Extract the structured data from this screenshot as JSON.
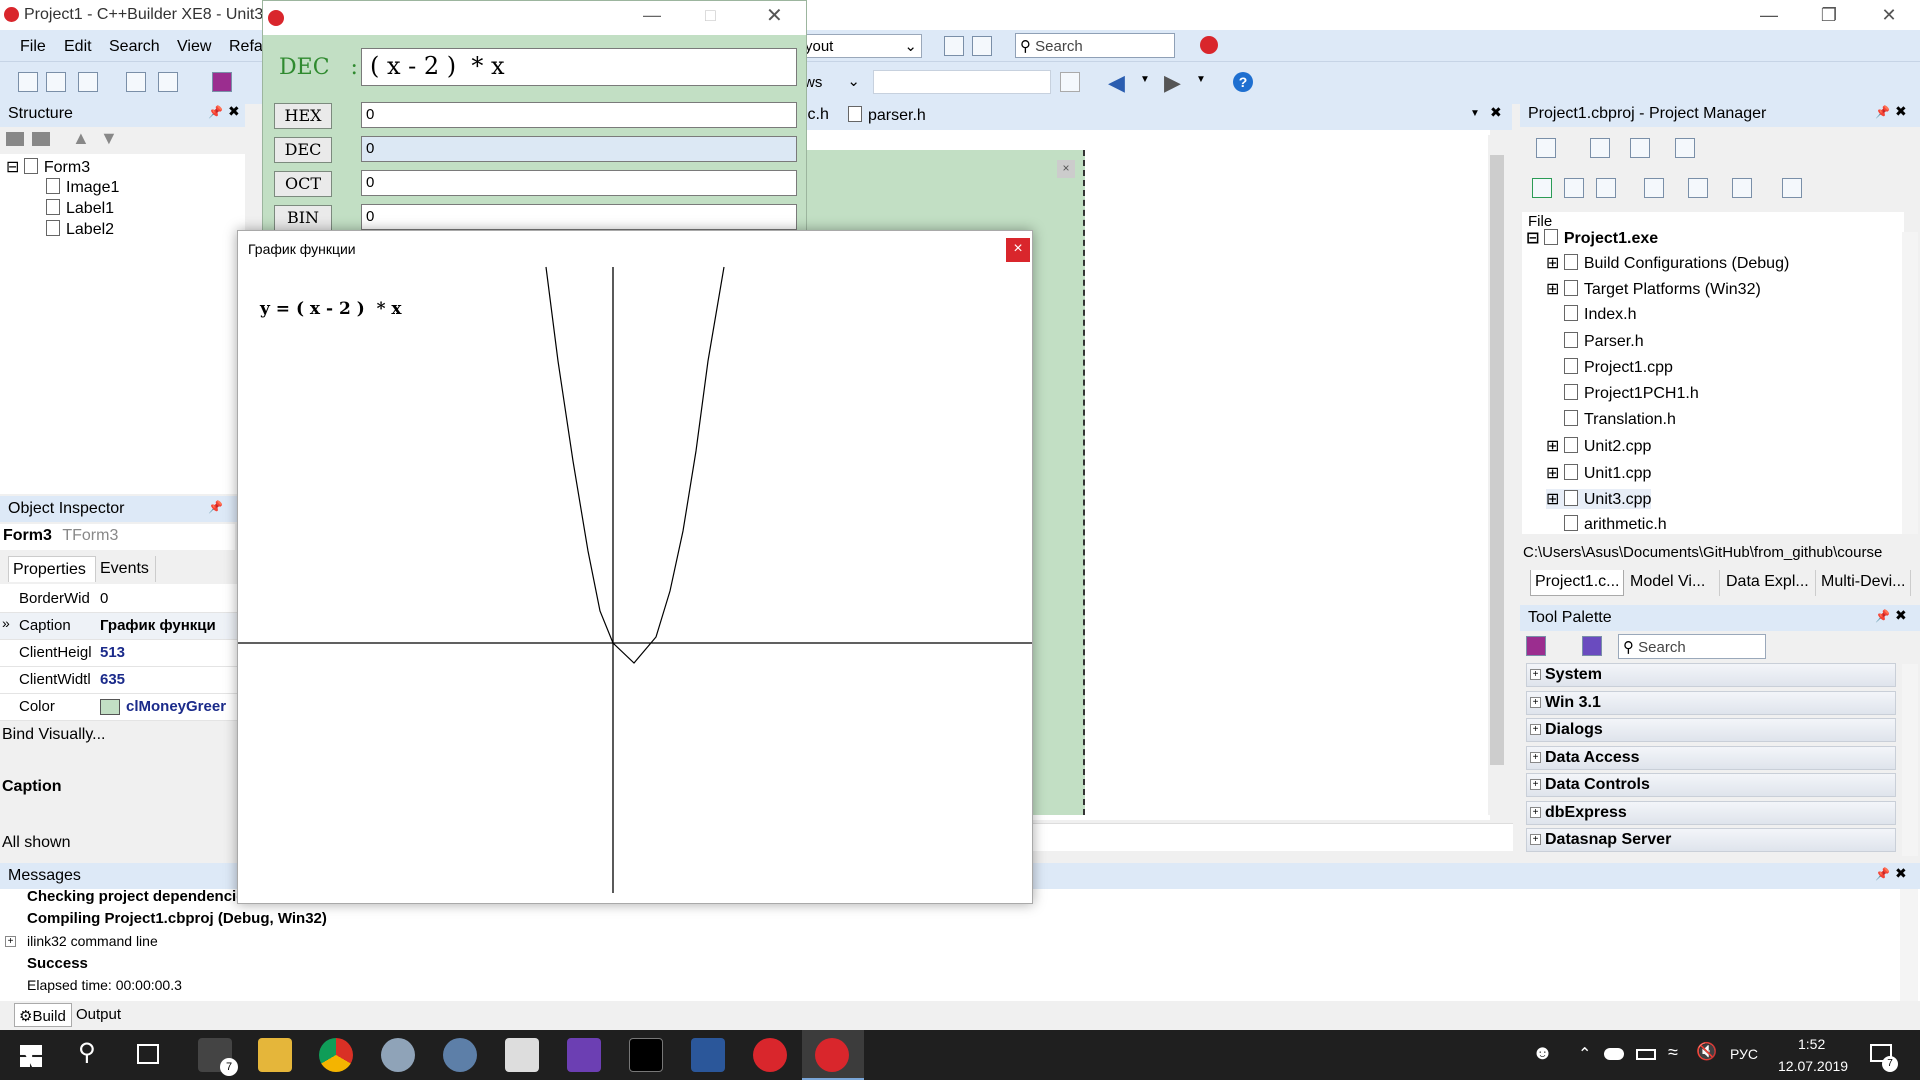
{
  "ide": {
    "title": "Project1 - C++Builder XE8 - Unit3.c",
    "menu": [
      "File",
      "Edit",
      "Search",
      "View",
      "Refa"
    ],
    "layout_combo": "yout",
    "layout_combo2": "ws",
    "search_placeholder": "Search",
    "editor_tabs": [
      "ic.h",
      "parser.h"
    ]
  },
  "calc": {
    "expression_label": "DEC   :",
    "expression": "( x - 2 )  * x",
    "rows": [
      {
        "label": "HEX",
        "value": "0"
      },
      {
        "label": "DEC",
        "value": "0"
      },
      {
        "label": "OCT",
        "value": "0"
      },
      {
        "label": "BIN",
        "value": "0"
      }
    ]
  },
  "graph": {
    "title": "График функции",
    "formula": "y = ( x - 2 )  * x",
    "close": "×"
  },
  "structure": {
    "title": "Structure",
    "items": [
      "Form3",
      "Image1",
      "Label1",
      "Label2"
    ]
  },
  "inspector": {
    "title": "Object Inspector",
    "object": "Form3",
    "object_type": "TForm3",
    "tabs": [
      "Properties",
      "Events"
    ],
    "props": [
      {
        "name": "BorderWid",
        "value": "0"
      },
      {
        "name": "Caption",
        "value": "График функци"
      },
      {
        "name": "ClientHeigl",
        "value": "513"
      },
      {
        "name": "ClientWidtl",
        "value": "635"
      },
      {
        "name": "Color",
        "value": "clMoneyGreer"
      }
    ],
    "bind_visually": "Bind Visually...",
    "selected_prop": "Caption",
    "all_shown": "All shown"
  },
  "messages": {
    "title": "Messages",
    "lines": [
      "Checking project dependencie",
      "Compiling Project1.cbproj (Debug, Win32)",
      "ilink32 command line",
      "Success",
      "Elapsed time: 00:00:00.3"
    ],
    "tabs": [
      "Build",
      "Output"
    ]
  },
  "project_manager": {
    "title": "Project1.cbproj - Project Manager",
    "file_header": "File",
    "root": "Project1.exe",
    "items": [
      "Build Configurations (Debug)",
      "Target Platforms (Win32)",
      "Index.h",
      "Parser.h",
      "Project1.cpp",
      "Project1PCH1.h",
      "Translation.h",
      "Unit2.cpp",
      "Unit1.cpp",
      "Unit3.cpp",
      "arithmetic.h"
    ],
    "path": "C:\\Users\\Asus\\Documents\\GitHub\\from_github\\course",
    "tabs": [
      "Project1.c...",
      "Model Vi...",
      "Data Expl...",
      "Multi-Devi..."
    ]
  },
  "tool_palette": {
    "title": "Tool Palette",
    "search_placeholder": "Search",
    "categories": [
      "System",
      "Win 3.1",
      "Dialogs",
      "Data Access",
      "Data Controls",
      "dbExpress",
      "Datasnap Server"
    ]
  },
  "taskbar": {
    "time": "1:52",
    "date": "12.07.2019",
    "lang": "РУС",
    "mail_badge": "7",
    "notif_badge": "7"
  },
  "colors": {
    "ide_chrome": "#dde9f7",
    "form_bg": "#c2dfc4",
    "accent": "#d9262c"
  }
}
